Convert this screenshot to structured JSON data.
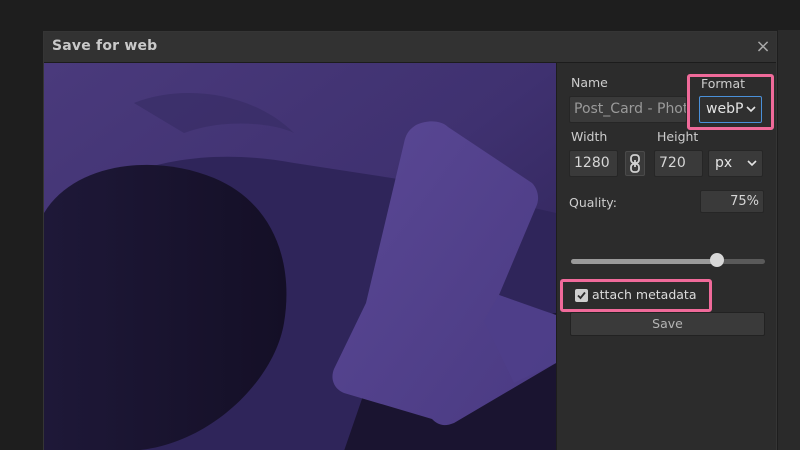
{
  "dialog": {
    "title": "Save for web",
    "close_label": "×"
  },
  "form": {
    "name_label": "Name",
    "name_value": "Post_Card - Photo",
    "format_label": "Format",
    "format_value": "webP",
    "width_label": "Width",
    "width_value": "1280",
    "height_label": "Height",
    "height_value": "720",
    "unit_value": "px",
    "quality_label": "Quality:",
    "quality_value": "75%",
    "quality_fraction": 0.75,
    "metadata_label": "attach metadata",
    "metadata_checked": true,
    "save_label": "Save"
  },
  "colors": {
    "highlight": "#f06a9a",
    "preview_tint": "#4a3a7a",
    "focus_border": "#4a90d9"
  },
  "icons": {
    "close": "close-icon",
    "link": "chain-link-icon",
    "dropdown": "chevron-down-icon",
    "check": "checkmark-icon"
  }
}
